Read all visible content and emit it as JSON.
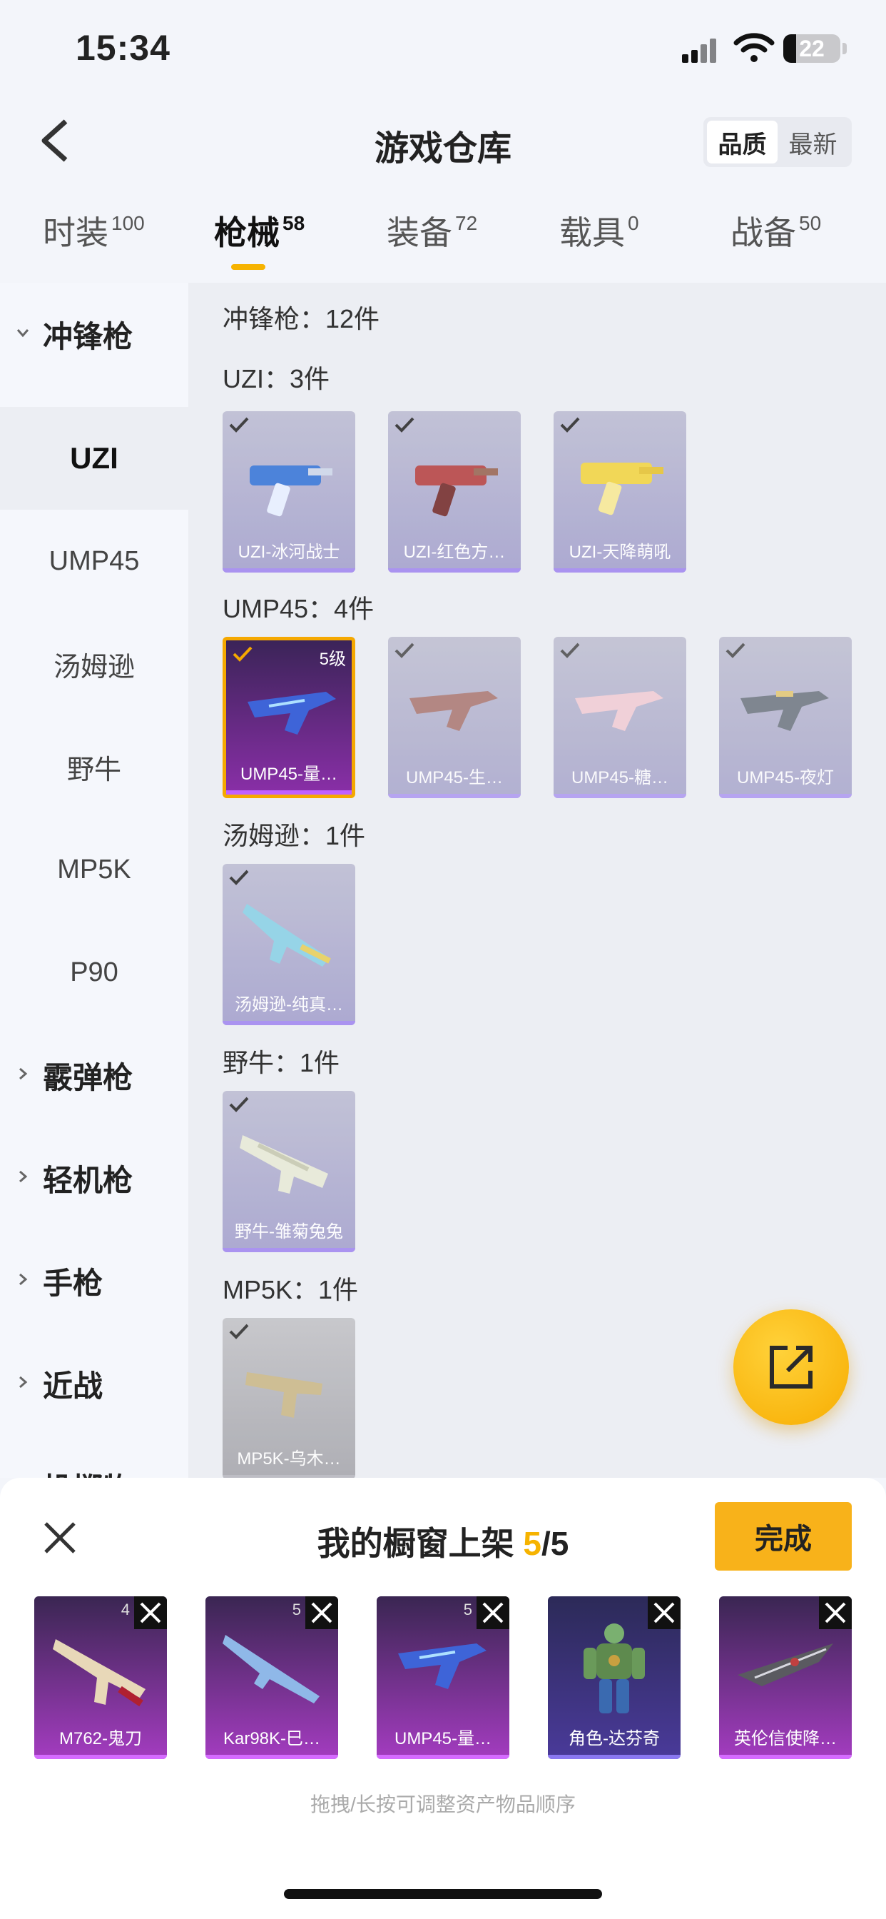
{
  "status_bar": {
    "time": "15:34",
    "battery": "22"
  },
  "header": {
    "title": "游戏仓库",
    "sort_options": [
      "品质",
      "最新"
    ],
    "sort_selected": "品质"
  },
  "categories": [
    {
      "label": "时装",
      "count": "100"
    },
    {
      "label": "枪械",
      "count": "58"
    },
    {
      "label": "装备",
      "count": "72"
    },
    {
      "label": "载具",
      "count": "0"
    },
    {
      "label": "战备",
      "count": "50"
    }
  ],
  "sidebar": {
    "group_open": "冲锋枪",
    "sub_items": [
      "UZI",
      "UMP45",
      "汤姆逊",
      "野牛",
      "MP5K",
      "P90"
    ],
    "groups_closed": [
      "霰弹枪",
      "轻机枪",
      "手枪",
      "近战"
    ],
    "partial_last": "投掷物"
  },
  "main": {
    "summary": "冲锋枪：12件",
    "sections": [
      {
        "title": "UZI：3件",
        "items": [
          "UZI-冰河战士",
          "UZI-红色方…",
          "UZI-天降萌吼"
        ]
      },
      {
        "title": "UMP45：4件",
        "items": [
          "UMP45-量…",
          "UMP45-生…",
          "UMP45-糖…",
          "UMP45-夜灯"
        ],
        "selected_level": "5级"
      },
      {
        "title": "汤姆逊：1件",
        "items": [
          "汤姆逊-纯真…"
        ]
      },
      {
        "title": "野牛：1件",
        "items": [
          "野牛-雏菊兔兔"
        ]
      },
      {
        "title": "MP5K：1件",
        "items": [
          "MP5K-乌木…"
        ]
      }
    ]
  },
  "sheet": {
    "title_prefix": "我的橱窗上架 ",
    "count": "5",
    "total": "/5",
    "done_label": "完成",
    "items": [
      {
        "name": "M762-鬼刀",
        "level": "4"
      },
      {
        "name": "Kar98K-巳…",
        "level": "5"
      },
      {
        "name": "UMP45-量…",
        "level": "5"
      },
      {
        "name": "角色-达芬奇",
        "level": ""
      },
      {
        "name": "英伦信使降…",
        "level": ""
      }
    ],
    "hint": "拖拽/长按可调整资产物品顺序"
  },
  "colors": {
    "accent": "#f6b300",
    "done_button": "#f8b21a",
    "card_purple": "#a43cc0"
  }
}
